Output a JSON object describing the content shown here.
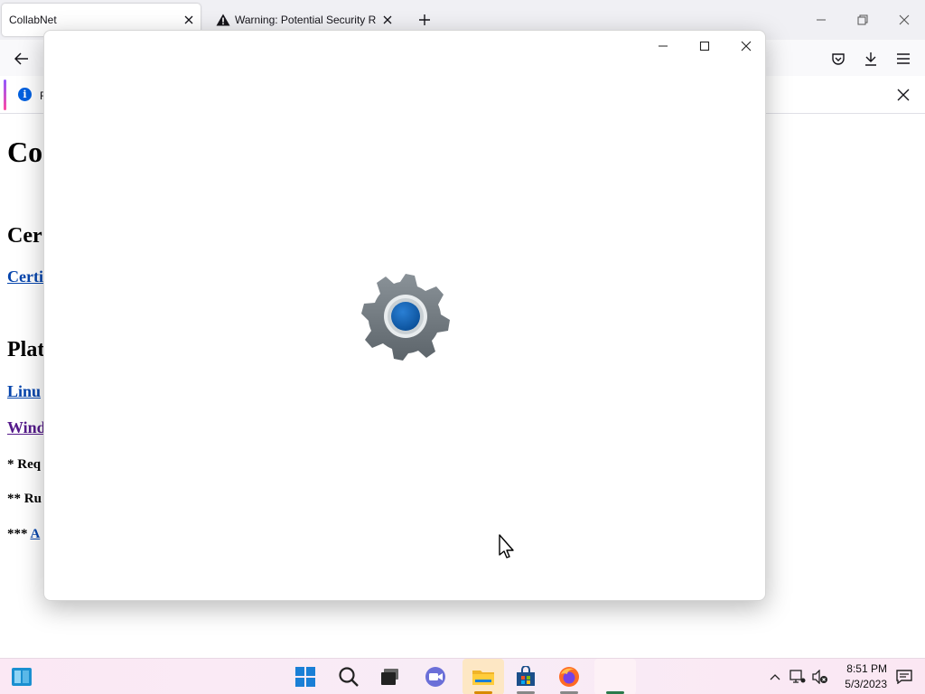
{
  "browser": {
    "tabs": [
      {
        "title": "CollabNet",
        "active": true
      },
      {
        "title": "Warning: Potential Security Risk Ahead",
        "active": false,
        "icon": "warning-icon"
      }
    ],
    "notification": {
      "text": "F"
    }
  },
  "page": {
    "heading": "Co",
    "section1_heading": "Cer",
    "link1": "Certi",
    "section2_heading": "Plat",
    "link_linux": "Linu",
    "link_windows": "Wind",
    "note1": "* Req",
    "note2": "** Ru",
    "note3_prefix": "*** ",
    "note3_link": "A"
  },
  "splash": {
    "app_icon": "settings-gear-icon"
  },
  "taskbar": {
    "apps": [
      "widgets-icon",
      "start-icon",
      "search-icon",
      "task-view-icon",
      "chat-icon",
      "file-explorer-icon",
      "store-icon",
      "firefox-icon",
      "settings-app"
    ],
    "clock": {
      "time": "8:51 PM",
      "date": "5/3/2023"
    }
  },
  "colors": {
    "link": "#0645ad",
    "visited": "#551a8b",
    "accent_blue": "#0a5fb4"
  }
}
